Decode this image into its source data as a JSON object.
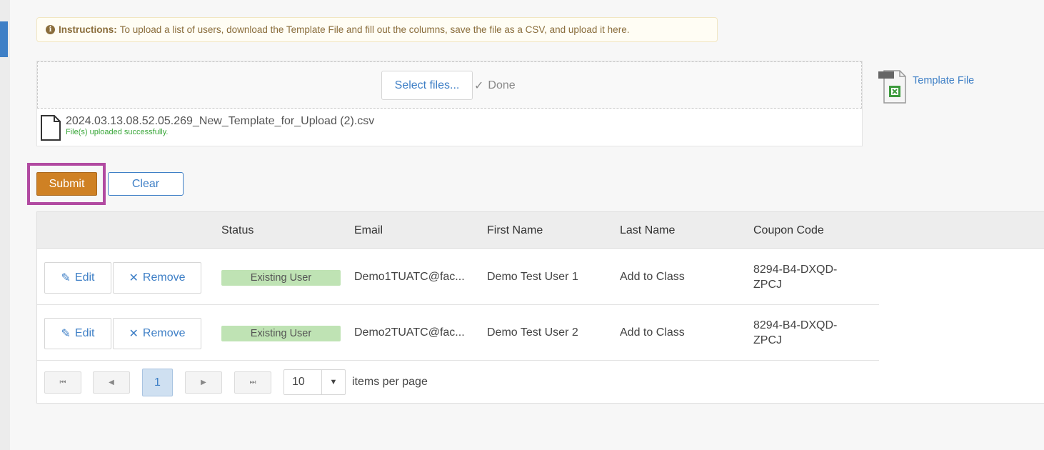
{
  "instructions": {
    "label": "Instructions:",
    "text": "To upload a list of users, download the Template File and fill out the columns, save the file as a CSV, and upload it here."
  },
  "upload": {
    "select_label": "Select files...",
    "done_label": "Done",
    "file_name": "2024.03.13.08.52.05.269_New_Template_for_Upload (2).csv",
    "file_status": "File(s) uploaded successfully."
  },
  "template": {
    "link_label": "Template File",
    "icon_text": "XLS"
  },
  "actions": {
    "submit_label": "Submit",
    "clear_label": "Clear"
  },
  "grid": {
    "headers": [
      "",
      "Status",
      "Email",
      "First Name",
      "Last Name",
      "Coupon Code"
    ],
    "rows": [
      {
        "edit_label": "Edit",
        "remove_label": "Remove",
        "status": "Existing User",
        "email": "Demo1TUATC@fac...",
        "first_name": "Demo Test User 1",
        "last_name": "Add to Class",
        "coupon_line1": "8294-B4-DXQD-",
        "coupon_line2": "ZPCJ"
      },
      {
        "edit_label": "Edit",
        "remove_label": "Remove",
        "status": "Existing User",
        "email": "Demo2TUATC@fac...",
        "first_name": "Demo Test User 2",
        "last_name": "Add to Class",
        "coupon_line1": "8294-B4-DXQD-",
        "coupon_line2": "ZPCJ"
      }
    ]
  },
  "pager": {
    "current_page": "1",
    "page_size": "10",
    "page_size_label": "items per page"
  },
  "colors": {
    "accent_blue": "#3e7fc6",
    "submit_orange": "#cf8124",
    "highlight_magenta": "#b14aa1",
    "status_green": "#bfe3b4",
    "success_text": "#38a638"
  },
  "icons": [
    "info-icon",
    "check-icon",
    "file-icon",
    "xls-file-icon",
    "pencil-icon",
    "x-icon",
    "first-page-icon",
    "prev-page-icon",
    "next-page-icon",
    "last-page-icon",
    "dropdown-arrow-icon"
  ]
}
